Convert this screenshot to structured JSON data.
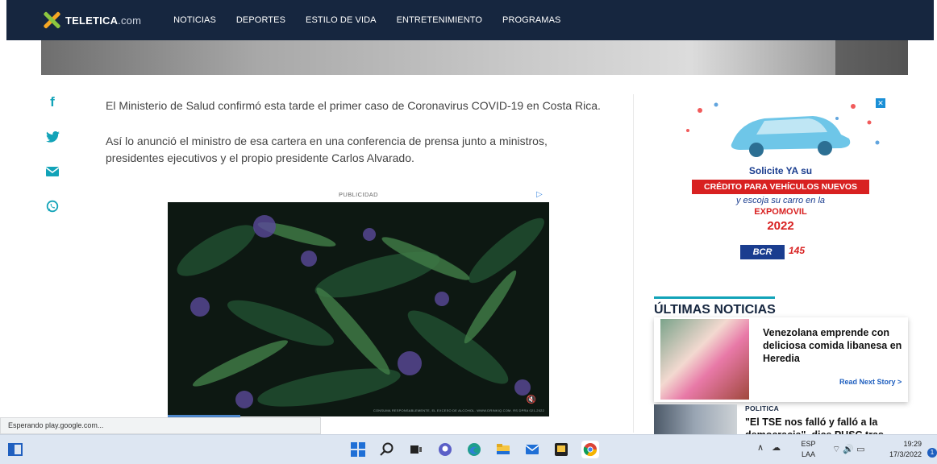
{
  "nav": {
    "logo_main": "TELETICA",
    "logo_suffix": ".com",
    "links": [
      "NOTICIAS",
      "DEPORTES",
      "ESTILO DE VIDA",
      "ENTRETENIMIENTO",
      "PROGRAMAS"
    ]
  },
  "share_icons": [
    "facebook-icon",
    "twitter-icon",
    "email-icon",
    "whatsapp-icon"
  ],
  "article": {
    "p1": "El Ministerio de Salud confirmó esta tarde el primer caso de Coronavirus COVID-19 en Costa Rica.",
    "p2_line1": "Así lo anunció el ministro de esa cartera en una conferencia de prensa junto a ministros,",
    "p2_line2": "presidentes ejecutivos y el propio presidente Carlos Alvarado.",
    "ad_label": "PUBLICIDAD",
    "video_fine_print": "CONSUMA RESPONSABLEMENTE, EL EXCESO DE ALCOHOL. WWW.DRINKIQ.COM. RS DPRA 021-2022",
    "video_progress": 0.19
  },
  "side_ad": {
    "line1": "Solicite YA su",
    "banner": "CRÉDITO PARA VEHÍCULOS NUEVOS",
    "line2": "y escoja su carro en la",
    "expo": "EXPOMOVIL",
    "year": "2022",
    "brand": "BCR",
    "anniv": "145"
  },
  "latest": {
    "title": "ÚLTIMAS NOTICIAS",
    "story_title": "Venezolana emprende con deliciosa comida libanesa en Heredia",
    "read_next": "Read Next Story >",
    "category": "POLITICA",
    "story2_line1": "\"El TSE nos falló y falló a la",
    "story2_line2": "democracia\", dice PUSC tras"
  },
  "status_text": "Esperando play.google.com...",
  "taskbar": {
    "lang_top": "ESP",
    "lang_bottom": "LAA",
    "time": "19:29",
    "date": "17/3/2022",
    "notifications": "1"
  },
  "colors": {
    "nav_bg": "#16263f",
    "accent": "#12a3b8",
    "ad_red": "#d82121",
    "ad_blue": "#1a3d8f"
  }
}
